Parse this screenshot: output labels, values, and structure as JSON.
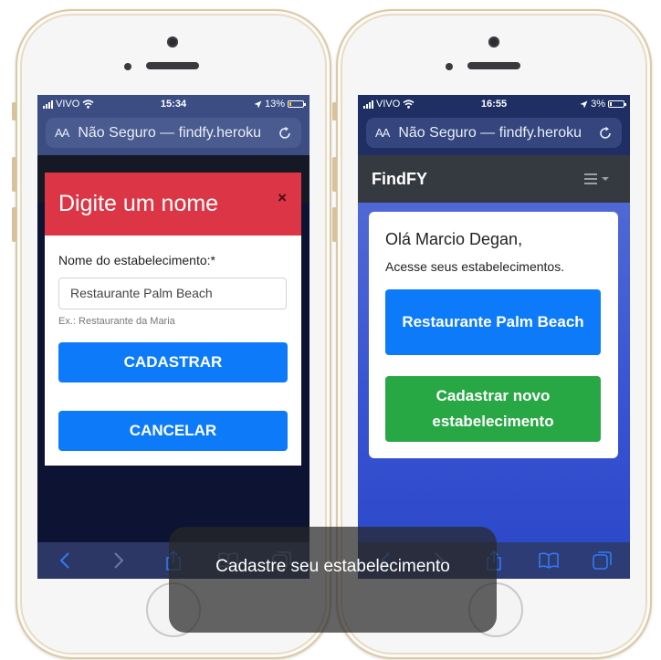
{
  "left": {
    "status": {
      "carrier": "VIVO",
      "time": "15:34",
      "battery": "13%",
      "battery_color": "#ffd60a",
      "battery_level": 0.13
    },
    "urlbar": {
      "aa": "AA",
      "url": "Não Seguro — findfy.heroku"
    },
    "modal": {
      "title": "Digite um nome",
      "close": "×",
      "field_label": "Nome do estabelecimento:*",
      "field_value": "Restaurante Palm Beach",
      "field_help": "Ex.: Restaurante da Maria",
      "submit_label": "CADASTRAR",
      "cancel_label": "CANCELAR"
    }
  },
  "right": {
    "status": {
      "carrier": "VIVO",
      "time": "16:55",
      "battery": "3%",
      "battery_level": 0.03
    },
    "urlbar": {
      "aa": "AA",
      "url": "Não Seguro — findfy.heroku"
    },
    "navbar": {
      "brand": "FindFY"
    },
    "card": {
      "greeting": "Olá Marcio Degan,",
      "subtitle": "Acesse seus estabelecimentos.",
      "establishment_button": "Restaurante Palm Beach",
      "new_button": "Cadastrar novo estabelecimento"
    }
  },
  "caption": "Cadastre seu estabelecimento",
  "colors": {
    "danger": "#dc3545",
    "primary": "#0d7bf9",
    "success": "#28a745",
    "navbar": "#343a40"
  }
}
